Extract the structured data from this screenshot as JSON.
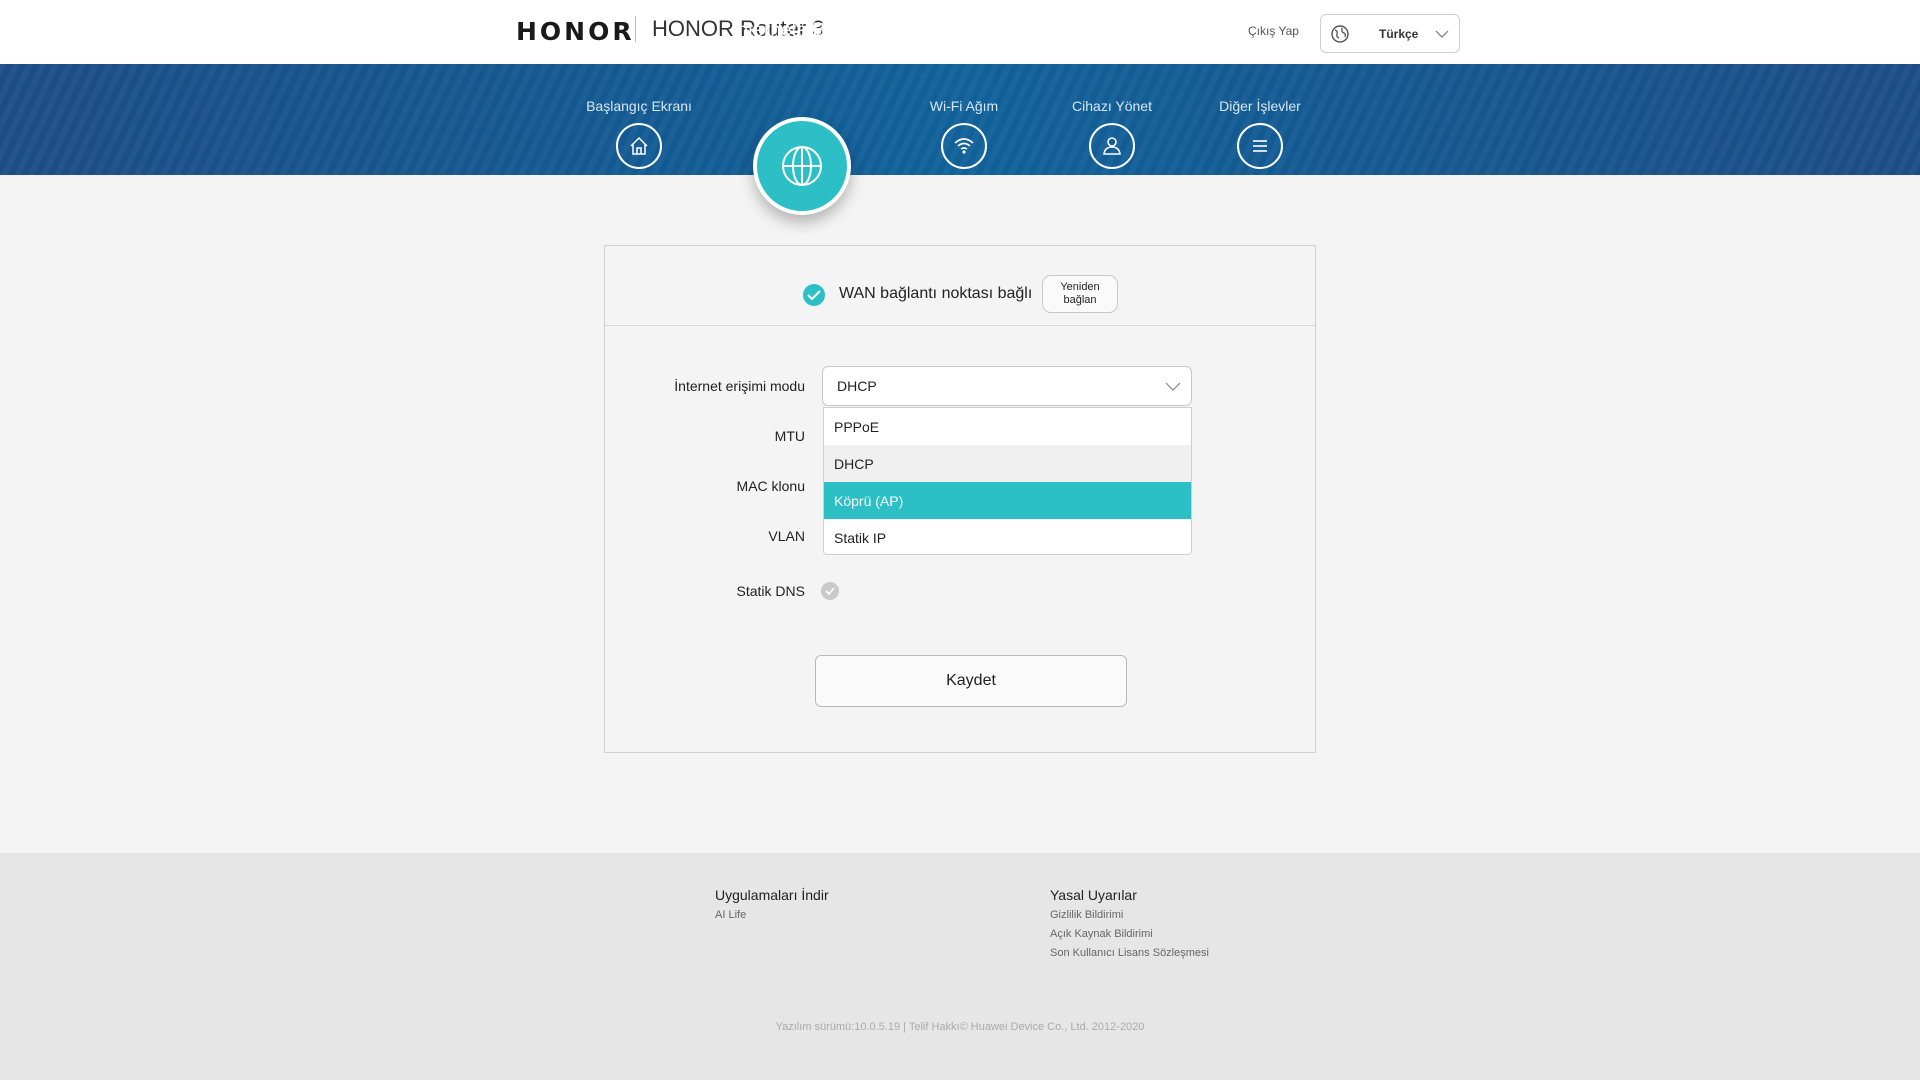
{
  "header": {
    "brand": "HONOR",
    "product_name": "HONOR Router 3",
    "logout_label": "Çıkış Yap",
    "language": "Türkçe"
  },
  "nav": {
    "items": [
      {
        "label": "Başlangıç Ekranı",
        "icon": "home-icon"
      },
      {
        "label": "İnternete Bağlan",
        "icon": "globe-icon",
        "active": true
      },
      {
        "label": "Wi-Fi Ağım",
        "icon": "wifi-icon"
      },
      {
        "label": "Cihazı Yönet",
        "icon": "user-icon"
      },
      {
        "label": "Diğer İşlevler",
        "icon": "menu-icon"
      }
    ]
  },
  "status": {
    "text": "WAN bağlantı noktası bağlı",
    "reconnect_line1": "Yeniden",
    "reconnect_line2": "bağlan"
  },
  "form": {
    "mode_label": "İnternet erişimi modu",
    "mode_value": "DHCP",
    "mtu_label": "MTU",
    "mac_label": "MAC klonu",
    "vlan_label": "VLAN",
    "dns_label": "Statik DNS",
    "dns_enabled": false,
    "options": [
      "PPPoE",
      "DHCP",
      "Köprü (AP)",
      "Statik IP"
    ],
    "hovered_option": "DHCP",
    "highlighted_option": "Köprü (AP)",
    "save_label": "Kaydet"
  },
  "footer": {
    "apps_title": "Uygulamaları İndir",
    "apps_links": [
      "AI Life"
    ],
    "legal_title": "Yasal Uyarılar",
    "legal_links": [
      "Gizlilik Bildirimi",
      "Açık Kaynak Bildirimi",
      "Son Kullanıcı Lisans Sözleşmesi"
    ],
    "copyright": "Yazılım sürümü:10.0.5.19 |   Telif Hakkı© Huawei Device Co., Ltd. 2012-2020"
  },
  "colors": {
    "accent": "#2cc0c6",
    "nav_band": "#155a93"
  }
}
